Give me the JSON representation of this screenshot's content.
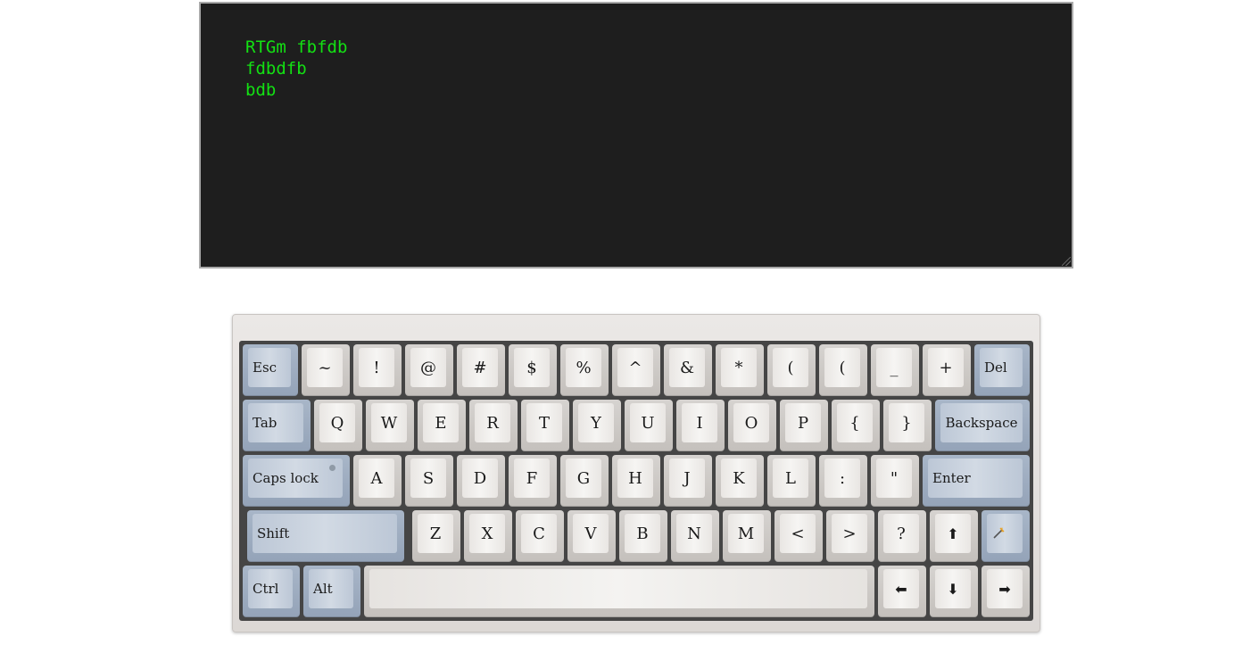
{
  "terminal": {
    "text": "RTGm fbfdb\nfdbdfb\nbdb"
  },
  "keyboard": {
    "row1": [
      "Esc",
      "~",
      "!",
      "@",
      "#",
      "$",
      "%",
      "^",
      "&",
      "*",
      "(",
      "(",
      "_",
      "+",
      "Del"
    ],
    "row2": [
      "Tab",
      "Q",
      "W",
      "E",
      "R",
      "T",
      "Y",
      "U",
      "I",
      "O",
      "P",
      "{",
      "}",
      "Backspace"
    ],
    "row3": [
      "Caps lock",
      "A",
      "S",
      "D",
      "F",
      "G",
      "H",
      "J",
      "K",
      "L",
      ":",
      "\"",
      "Enter"
    ],
    "row4": [
      "Shift",
      "Z",
      "X",
      "C",
      "V",
      "B",
      "N",
      "M",
      "<",
      ">",
      "?",
      "⬆"
    ],
    "row5": [
      "Ctrl",
      "Alt",
      "",
      "⬅",
      "⬇",
      "➡"
    ],
    "colors": {
      "terminal_bg": "#1e1e1e",
      "terminal_text": "#13e013",
      "modifier_key": "#c8d1de",
      "letter_key": "#f0eeec",
      "plate": "#454545"
    }
  }
}
